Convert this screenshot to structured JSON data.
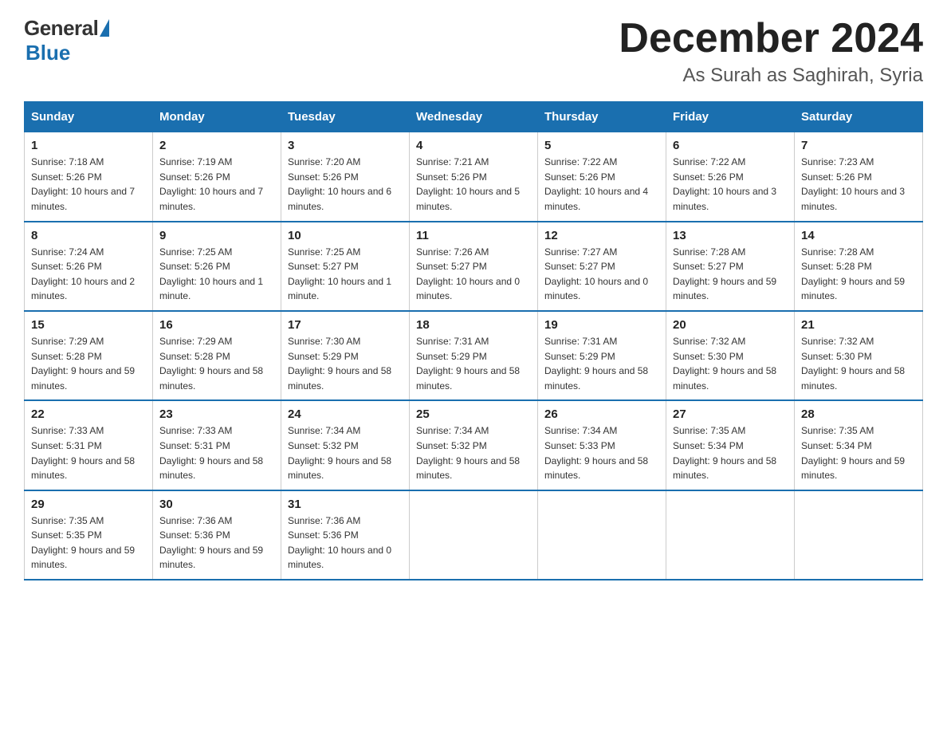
{
  "logo": {
    "general": "General",
    "blue": "Blue"
  },
  "title": {
    "month": "December 2024",
    "location": "As Surah as Saghirah, Syria"
  },
  "headers": [
    "Sunday",
    "Monday",
    "Tuesday",
    "Wednesday",
    "Thursday",
    "Friday",
    "Saturday"
  ],
  "weeks": [
    [
      {
        "day": "1",
        "sunrise": "7:18 AM",
        "sunset": "5:26 PM",
        "daylight": "10 hours and 7 minutes."
      },
      {
        "day": "2",
        "sunrise": "7:19 AM",
        "sunset": "5:26 PM",
        "daylight": "10 hours and 7 minutes."
      },
      {
        "day": "3",
        "sunrise": "7:20 AM",
        "sunset": "5:26 PM",
        "daylight": "10 hours and 6 minutes."
      },
      {
        "day": "4",
        "sunrise": "7:21 AM",
        "sunset": "5:26 PM",
        "daylight": "10 hours and 5 minutes."
      },
      {
        "day": "5",
        "sunrise": "7:22 AM",
        "sunset": "5:26 PM",
        "daylight": "10 hours and 4 minutes."
      },
      {
        "day": "6",
        "sunrise": "7:22 AM",
        "sunset": "5:26 PM",
        "daylight": "10 hours and 3 minutes."
      },
      {
        "day": "7",
        "sunrise": "7:23 AM",
        "sunset": "5:26 PM",
        "daylight": "10 hours and 3 minutes."
      }
    ],
    [
      {
        "day": "8",
        "sunrise": "7:24 AM",
        "sunset": "5:26 PM",
        "daylight": "10 hours and 2 minutes."
      },
      {
        "day": "9",
        "sunrise": "7:25 AM",
        "sunset": "5:26 PM",
        "daylight": "10 hours and 1 minute."
      },
      {
        "day": "10",
        "sunrise": "7:25 AM",
        "sunset": "5:27 PM",
        "daylight": "10 hours and 1 minute."
      },
      {
        "day": "11",
        "sunrise": "7:26 AM",
        "sunset": "5:27 PM",
        "daylight": "10 hours and 0 minutes."
      },
      {
        "day": "12",
        "sunrise": "7:27 AM",
        "sunset": "5:27 PM",
        "daylight": "10 hours and 0 minutes."
      },
      {
        "day": "13",
        "sunrise": "7:28 AM",
        "sunset": "5:27 PM",
        "daylight": "9 hours and 59 minutes."
      },
      {
        "day": "14",
        "sunrise": "7:28 AM",
        "sunset": "5:28 PM",
        "daylight": "9 hours and 59 minutes."
      }
    ],
    [
      {
        "day": "15",
        "sunrise": "7:29 AM",
        "sunset": "5:28 PM",
        "daylight": "9 hours and 59 minutes."
      },
      {
        "day": "16",
        "sunrise": "7:29 AM",
        "sunset": "5:28 PM",
        "daylight": "9 hours and 58 minutes."
      },
      {
        "day": "17",
        "sunrise": "7:30 AM",
        "sunset": "5:29 PM",
        "daylight": "9 hours and 58 minutes."
      },
      {
        "day": "18",
        "sunrise": "7:31 AM",
        "sunset": "5:29 PM",
        "daylight": "9 hours and 58 minutes."
      },
      {
        "day": "19",
        "sunrise": "7:31 AM",
        "sunset": "5:29 PM",
        "daylight": "9 hours and 58 minutes."
      },
      {
        "day": "20",
        "sunrise": "7:32 AM",
        "sunset": "5:30 PM",
        "daylight": "9 hours and 58 minutes."
      },
      {
        "day": "21",
        "sunrise": "7:32 AM",
        "sunset": "5:30 PM",
        "daylight": "9 hours and 58 minutes."
      }
    ],
    [
      {
        "day": "22",
        "sunrise": "7:33 AM",
        "sunset": "5:31 PM",
        "daylight": "9 hours and 58 minutes."
      },
      {
        "day": "23",
        "sunrise": "7:33 AM",
        "sunset": "5:31 PM",
        "daylight": "9 hours and 58 minutes."
      },
      {
        "day": "24",
        "sunrise": "7:34 AM",
        "sunset": "5:32 PM",
        "daylight": "9 hours and 58 minutes."
      },
      {
        "day": "25",
        "sunrise": "7:34 AM",
        "sunset": "5:32 PM",
        "daylight": "9 hours and 58 minutes."
      },
      {
        "day": "26",
        "sunrise": "7:34 AM",
        "sunset": "5:33 PM",
        "daylight": "9 hours and 58 minutes."
      },
      {
        "day": "27",
        "sunrise": "7:35 AM",
        "sunset": "5:34 PM",
        "daylight": "9 hours and 58 minutes."
      },
      {
        "day": "28",
        "sunrise": "7:35 AM",
        "sunset": "5:34 PM",
        "daylight": "9 hours and 59 minutes."
      }
    ],
    [
      {
        "day": "29",
        "sunrise": "7:35 AM",
        "sunset": "5:35 PM",
        "daylight": "9 hours and 59 minutes."
      },
      {
        "day": "30",
        "sunrise": "7:36 AM",
        "sunset": "5:36 PM",
        "daylight": "9 hours and 59 minutes."
      },
      {
        "day": "31",
        "sunrise": "7:36 AM",
        "sunset": "5:36 PM",
        "daylight": "10 hours and 0 minutes."
      },
      null,
      null,
      null,
      null
    ]
  ],
  "labels": {
    "sunrise": "Sunrise: ",
    "sunset": "Sunset: ",
    "daylight": "Daylight: "
  }
}
